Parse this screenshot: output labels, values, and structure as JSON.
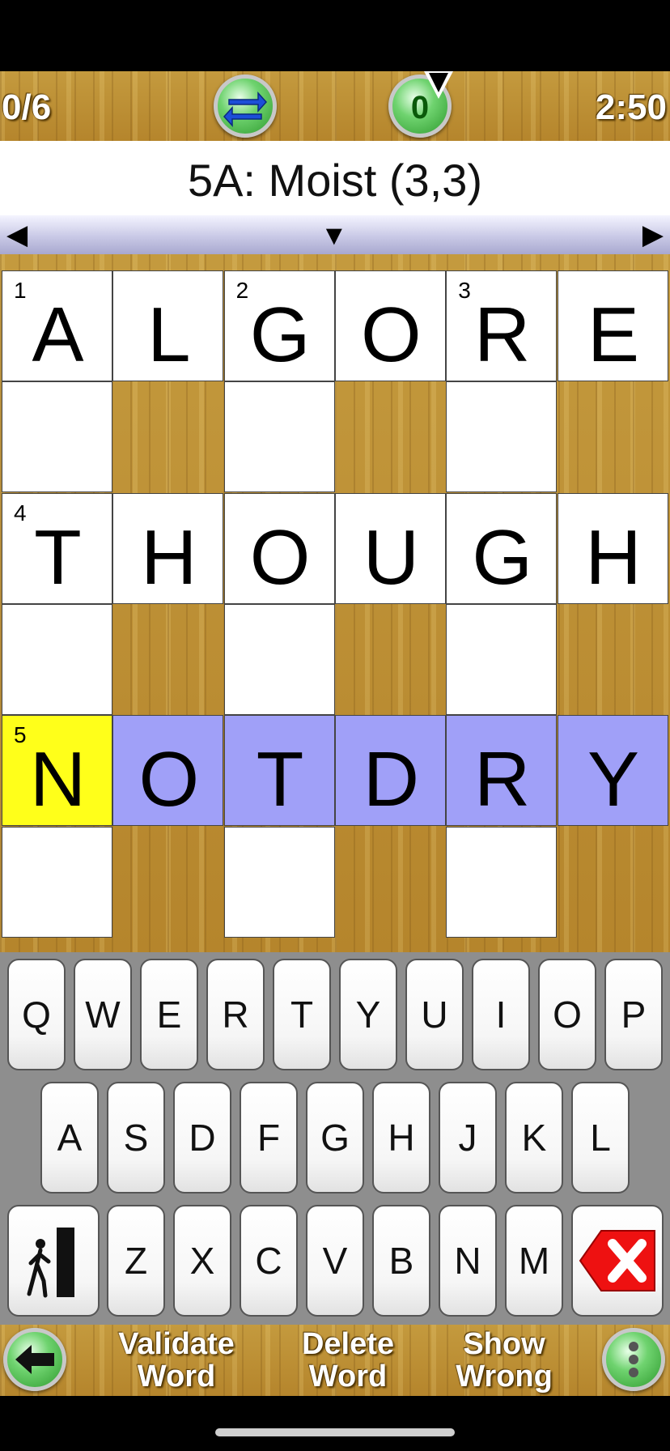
{
  "topbar": {
    "score": "0/6",
    "timer": "2:50",
    "hint_count": "0",
    "swap_icon": "swap-arrows-icon",
    "hint_icon": "hint-icon"
  },
  "clue": {
    "text": "5A: Moist (3,3)"
  },
  "nav": {
    "left": "◀",
    "down": "▼",
    "right": "▶"
  },
  "grid": {
    "rows": 6,
    "cols": 6,
    "cells": [
      {
        "r": 0,
        "c": 0,
        "num": "1",
        "letter": "A"
      },
      {
        "r": 0,
        "c": 1,
        "num": "",
        "letter": "L"
      },
      {
        "r": 0,
        "c": 2,
        "num": "2",
        "letter": "G"
      },
      {
        "r": 0,
        "c": 3,
        "num": "",
        "letter": "O"
      },
      {
        "r": 0,
        "c": 4,
        "num": "3",
        "letter": "R"
      },
      {
        "r": 0,
        "c": 5,
        "num": "",
        "letter": "E"
      },
      {
        "r": 1,
        "c": 0,
        "num": "",
        "letter": ""
      },
      {
        "r": 1,
        "c": 2,
        "num": "",
        "letter": ""
      },
      {
        "r": 1,
        "c": 4,
        "num": "",
        "letter": ""
      },
      {
        "r": 2,
        "c": 0,
        "num": "4",
        "letter": "T"
      },
      {
        "r": 2,
        "c": 1,
        "num": "",
        "letter": "H"
      },
      {
        "r": 2,
        "c": 2,
        "num": "",
        "letter": "O"
      },
      {
        "r": 2,
        "c": 3,
        "num": "",
        "letter": "U"
      },
      {
        "r": 2,
        "c": 4,
        "num": "",
        "letter": "G"
      },
      {
        "r": 2,
        "c": 5,
        "num": "",
        "letter": "H"
      },
      {
        "r": 3,
        "c": 0,
        "num": "",
        "letter": ""
      },
      {
        "r": 3,
        "c": 2,
        "num": "",
        "letter": ""
      },
      {
        "r": 3,
        "c": 4,
        "num": "",
        "letter": ""
      },
      {
        "r": 4,
        "c": 0,
        "num": "5",
        "letter": "N",
        "state": "cur"
      },
      {
        "r": 4,
        "c": 1,
        "num": "",
        "letter": "O",
        "state": "sel"
      },
      {
        "r": 4,
        "c": 2,
        "num": "",
        "letter": "T",
        "state": "sel"
      },
      {
        "r": 4,
        "c": 3,
        "num": "",
        "letter": "D",
        "state": "sel"
      },
      {
        "r": 4,
        "c": 4,
        "num": "",
        "letter": "R",
        "state": "sel"
      },
      {
        "r": 4,
        "c": 5,
        "num": "",
        "letter": "Y",
        "state": "sel"
      },
      {
        "r": 5,
        "c": 0,
        "num": "",
        "letter": ""
      },
      {
        "r": 5,
        "c": 2,
        "num": "",
        "letter": ""
      },
      {
        "r": 5,
        "c": 4,
        "num": "",
        "letter": ""
      }
    ],
    "colors": {
      "current": "#ffff1a",
      "selected_word": "#a0a0f8"
    }
  },
  "keyboard": {
    "row1": [
      "Q",
      "W",
      "E",
      "R",
      "T",
      "Y",
      "U",
      "I",
      "O",
      "P"
    ],
    "row2": [
      "A",
      "S",
      "D",
      "F",
      "G",
      "H",
      "J",
      "K",
      "L"
    ],
    "row3": [
      "Z",
      "X",
      "C",
      "V",
      "B",
      "N",
      "M"
    ],
    "exit_icon": "exit-door-icon",
    "delete_icon": "delete-x-icon"
  },
  "bottombar": {
    "validate_line1": "Validate",
    "validate_line2": "Word",
    "delete_line1": "Delete",
    "delete_line2": "Word",
    "show_line1": "Show",
    "show_line2": "Wrong",
    "back_icon": "back-arrow-icon",
    "menu_icon": "menu-dots-icon"
  }
}
